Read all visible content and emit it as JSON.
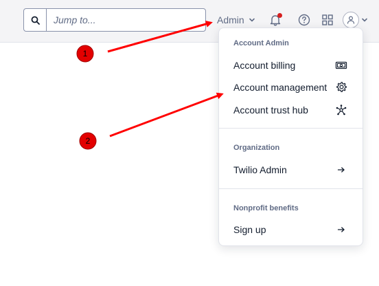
{
  "search": {
    "placeholder": "Jump to...",
    "icon": "search-icon"
  },
  "header": {
    "account_label": "Admin",
    "icons": [
      "bell-icon",
      "help-icon",
      "app-grid-icon",
      "user-icon"
    ],
    "notification_dot_color": "#d61f1f"
  },
  "menu": {
    "sections": [
      {
        "title": "Account Admin",
        "items": [
          {
            "label": "Account billing",
            "icon": "billing-icon"
          },
          {
            "label": "Account management",
            "icon": "gear-icon"
          },
          {
            "label": "Account trust hub",
            "icon": "trust-hub-icon"
          }
        ]
      },
      {
        "title": "Organization",
        "items": [
          {
            "label": "Twilio Admin",
            "icon": "arrow-right-icon"
          }
        ]
      },
      {
        "title": "Nonprofit benefits",
        "items": [
          {
            "label": "Sign up",
            "icon": "arrow-right-icon"
          }
        ]
      }
    ]
  },
  "annotations": {
    "markers": [
      {
        "label": "1"
      },
      {
        "label": "2"
      }
    ],
    "color": "#ff0000"
  }
}
